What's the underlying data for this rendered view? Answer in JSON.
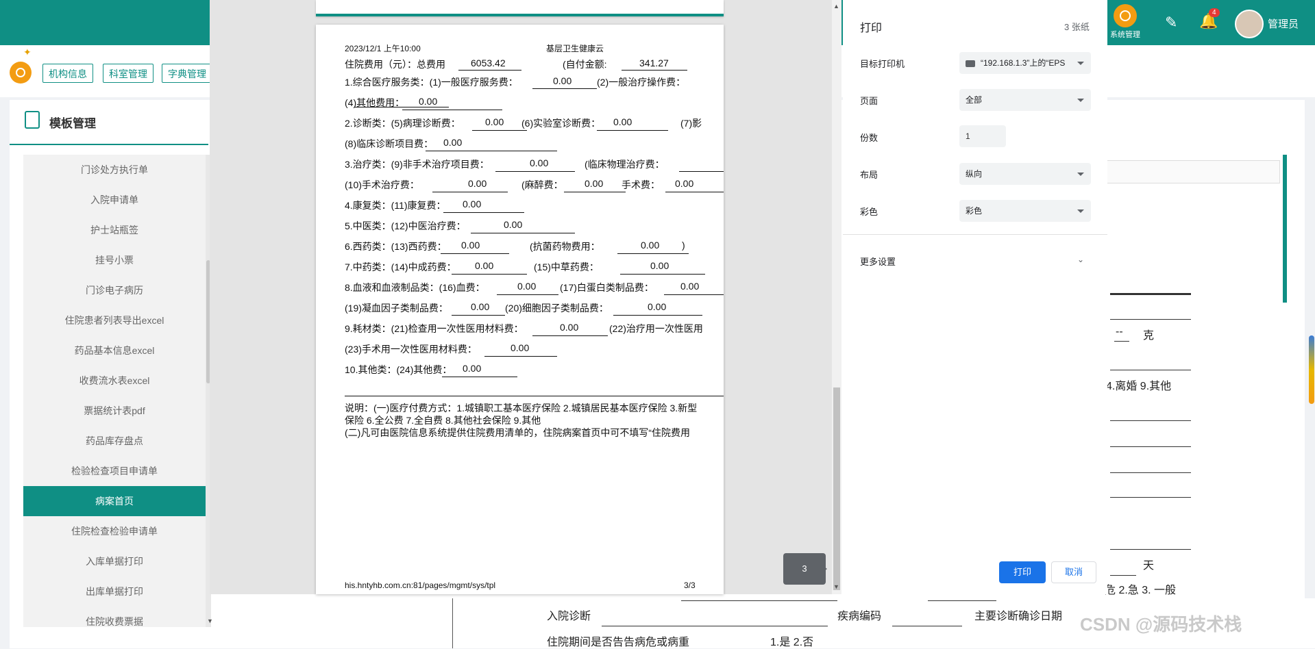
{
  "topbar": {
    "system_label": "系统管理",
    "notification_count": "4",
    "user_name": "管理员"
  },
  "tabs": [
    "机构信息",
    "科室管理",
    "字典管理"
  ],
  "panel": {
    "title": "模板管理"
  },
  "sidebar": {
    "items": [
      "门诊处方执行单",
      "入院申请单",
      "护士站瓶签",
      "挂号小票",
      "门诊电子病历",
      "住院患者列表导出excel",
      "药品基本信息excel",
      "收费流水表excel",
      "票据统计表pdf",
      "药品库存盘点",
      "检验检查项目申请单",
      "病案首页",
      "住院检查检验申请单",
      "入库单据打印",
      "出库单据打印",
      "住院收费票据"
    ],
    "active": "病案首页"
  },
  "right_form": {
    "gram_dash": "--",
    "gram_unit": "克",
    "marital": "4.离婚 9.其他",
    "days_unit": "天",
    "urgency": "危 2.急 3. 一般",
    "admit_diag": "入院诊断",
    "disease_code": "疾病编码",
    "main_diag_date": "主要诊断确诊日期",
    "critical_notice": "住院期间是否告告病危或病重",
    "yes_no": "1.是 2.否",
    "watermark": "CSDN @源码技术栈"
  },
  "print_preview": {
    "header_date": "2023/12/1 上午10:00",
    "header_site": "基层卫生健康云",
    "footer_url": "his.hntyhb.com.cn:81/pages/mgmt/sys/tpl",
    "footer_page": "3/3",
    "page_badge": "3",
    "lines": {
      "l1a": "住院费用（元）：总费用",
      "l1v": "6053.42",
      "l1b": "(自付金额:",
      "l1w": "341.27",
      "l2a": "1.综合医疗服务类：(1)一般医疗服务费：",
      "l2v": "0.00",
      "l2b": "(2)一般治疗操作费：",
      "l3a": "(4)其他费用：",
      "l3v": "0.00",
      "l4a": "2.诊断类：(5)病理诊断费：",
      "l4v": "0.00",
      "l4b": "(6)实验室诊断费：",
      "l4w": "0.00",
      "l4c": "(7)影",
      "l5a": "(8)临床诊断项目费：",
      "l5v": "0.00",
      "l6a": "3.治疗类：(9)非手术治疗项目费：",
      "l6v": "0.00",
      "l6b": "(临床物理治疗费：",
      "l7a": "(10)手术治疗费：",
      "l7v": "0.00",
      "l7b": "(麻醉费：",
      "l7w": "0.00",
      "l7c": "手术费：",
      "l7x": "0.00",
      "l8a": "4.康复类：(11)康复费：",
      "l8v": "0.00",
      "l9a": "5.中医类：(12)中医治疗费：",
      "l9v": "0.00",
      "l10a": "6.西药类：(13)西药费：",
      "l10v": "0.00",
      "l10b": "(抗菌药物费用：",
      "l10w": "0.00",
      "l10c": ")",
      "l11a": "7.中药类：(14)中成药费：",
      "l11v": "0.00",
      "l11b": "(15)中草药费：",
      "l11w": "0.00",
      "l12a": "8.血液和血液制品类：(16)血费：",
      "l12v": "0.00",
      "l12b": "(17)白蛋白类制品费：",
      "l12w": "0.00",
      "l13a": "(19)凝血因子类制品费：",
      "l13v": "0.00",
      "l13b": "(20)细胞因子类制品费：",
      "l13w": "0.00",
      "l14a": "9.耗材类：(21)检查用一次性医用材料费：",
      "l14v": "0.00",
      "l14b": "(22)治疗用一次性医用",
      "l15a": "(23)手术用一次性医用材料费：",
      "l15v": "0.00",
      "l16a": "10.其他类：(24)其他费：",
      "l16v": "0.00",
      "n1": "说明：(一)医疗付费方式：1.城镇职工基本医疗保险 2.城镇居民基本医疗保险 3.新型",
      "n2": "保险 6.全公费 7.全自费 8.其他社会保险 9.其他",
      "n3": "(二)凡可由医院信息系统提供住院费用清单的，住院病案首页中可不填写“住院费用"
    }
  },
  "print_settings": {
    "title": "打印",
    "sheets": "3 张纸",
    "printer_label": "目标打印机",
    "printer_value": "“192.168.1.3”上的“EPS",
    "pages_label": "页面",
    "pages_value": "全部",
    "copies_label": "份数",
    "copies_value": "1",
    "layout_label": "布局",
    "layout_value": "纵向",
    "color_label": "彩色",
    "color_value": "彩色",
    "more_settings": "更多设置",
    "print_button": "打印",
    "cancel_button": "取消"
  },
  "colors": {
    "brand": "#0f8f84",
    "accent": "#1a73e8",
    "badge": "#e53935"
  }
}
